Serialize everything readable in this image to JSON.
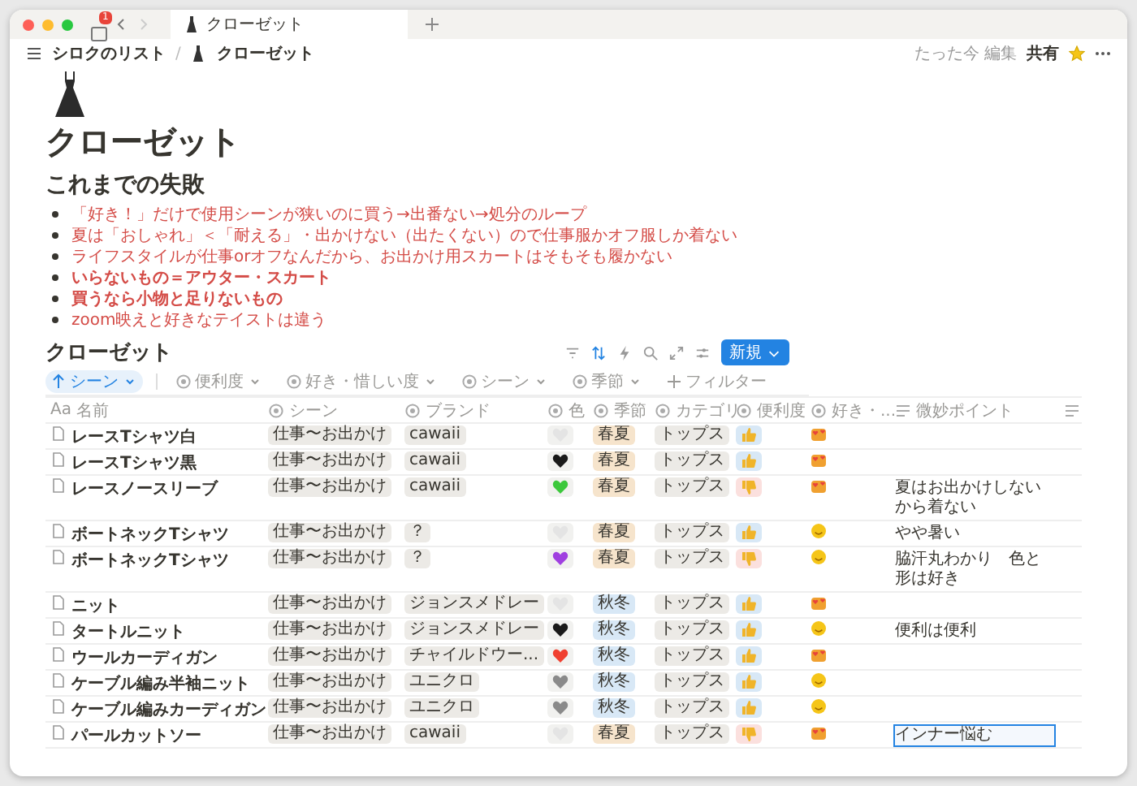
{
  "window": {
    "tab_title": "クローゼット",
    "sidebar_badge": "1"
  },
  "breadcrumb": {
    "items": [
      "シロクのリスト",
      "クローゼット"
    ],
    "separator": "/"
  },
  "topbar": {
    "edited": "たった今 編集",
    "share": "共有",
    "favorite": true
  },
  "page": {
    "title": "クローゼット",
    "heading": "これまでの失敗",
    "bullets": [
      {
        "text": "「好き！」だけで使用シーンが狭いのに買う→出番ない→処分のループ",
        "bold": false
      },
      {
        "text": "夏は「おしゃれ」＜「耐える」・出かけない（出たくない）ので仕事服かオフ服しか着ない",
        "bold": false
      },
      {
        "text": "ライフスタイルが仕事orオフなんだから、お出かけ用スカートはそもそも履かない",
        "bold": false
      },
      {
        "text": "いらないもの＝アウター・スカート",
        "bold": true
      },
      {
        "text": "買うなら小物と足りないもの",
        "bold": true
      },
      {
        "text": "zoom映えと好きなテイストは違う",
        "bold": false
      }
    ]
  },
  "database": {
    "title": "クローゼット",
    "new_button": "新規",
    "filters": [
      {
        "label": "シーン",
        "kind": "sort",
        "active": true
      },
      {
        "label": "便利度",
        "kind": "select",
        "active": false
      },
      {
        "label": "好き・惜しい度",
        "kind": "select",
        "active": false
      },
      {
        "label": "シーン",
        "kind": "select",
        "active": false
      },
      {
        "label": "季節",
        "kind": "select",
        "active": false
      },
      {
        "label": "フィルター",
        "kind": "add",
        "active": false
      }
    ],
    "columns": [
      {
        "label": "名前",
        "kind": "title",
        "prefix": "Aa"
      },
      {
        "label": "シーン",
        "kind": "select"
      },
      {
        "label": "ブランド",
        "kind": "select"
      },
      {
        "label": "色",
        "kind": "select"
      },
      {
        "label": "季節",
        "kind": "select"
      },
      {
        "label": "カテゴリ",
        "kind": "select"
      },
      {
        "label": "便利度",
        "kind": "select"
      },
      {
        "label": "好き・...",
        "kind": "select"
      },
      {
        "label": "微妙ポイント",
        "kind": "text"
      }
    ],
    "rows": [
      {
        "name": "レースTシャツ白",
        "scene": "仕事〜お出かけ",
        "brand": "cawaii",
        "color": "#e4e4e4",
        "season": {
          "label": "春夏",
          "color": "#f6e4cc"
        },
        "category": "トップス",
        "useful": {
          "kind": "up"
        },
        "liking": {
          "kind": "love"
        }
      },
      {
        "name": "レースTシャツ黒",
        "scene": "仕事〜お出かけ",
        "brand": "cawaii",
        "color": "#1a1a1a",
        "season": {
          "label": "春夏",
          "color": "#f6e4cc"
        },
        "category": "トップス",
        "useful": {
          "kind": "up"
        },
        "liking": {
          "kind": "love"
        }
      },
      {
        "name": "レースノースリーブ",
        "scene": "仕事〜お出かけ",
        "brand": "cawaii",
        "color": "#3cc83c",
        "season": {
          "label": "春夏",
          "color": "#f6e4cc"
        },
        "category": "トップス",
        "useful": {
          "kind": "down"
        },
        "liking": {
          "kind": "love"
        },
        "note": {
          "text": "夏はお出かけしないから着ない",
          "selected": false
        }
      },
      {
        "name": "ボートネックTシャツ",
        "scene": "仕事〜お出かけ",
        "brand": "？",
        "color": "#e4e4e4",
        "season": {
          "label": "春夏",
          "color": "#f6e4cc"
        },
        "category": "トップス",
        "useful": {
          "kind": "up"
        },
        "liking": {
          "kind": "ok"
        },
        "note": {
          "text": "やや暑い",
          "selected": false
        }
      },
      {
        "name": "ボートネックTシャツ",
        "scene": "仕事〜お出かけ",
        "brand": "？",
        "color": "#a040e0",
        "season": {
          "label": "春夏",
          "color": "#f6e4cc"
        },
        "category": "トップス",
        "useful": {
          "kind": "down"
        },
        "liking": {
          "kind": "ok"
        },
        "note": {
          "text": "脇汗丸わかり　色と形は好き",
          "selected": false
        }
      },
      {
        "name": "ニット",
        "scene": "仕事〜お出かけ",
        "brand": "ジョンスメドレー",
        "color": "#e4e4e4",
        "season": {
          "label": "秋冬",
          "color": "#d8e8f6"
        },
        "category": "トップス",
        "useful": {
          "kind": "up"
        },
        "liking": {
          "kind": "love"
        }
      },
      {
        "name": "タートルニット",
        "scene": "仕事〜お出かけ",
        "brand": "ジョンスメドレー",
        "color": "#1a1a1a",
        "season": {
          "label": "秋冬",
          "color": "#d8e8f6"
        },
        "category": "トップス",
        "useful": {
          "kind": "up"
        },
        "liking": {
          "kind": "ok"
        },
        "note": {
          "text": "便利は便利",
          "selected": false
        }
      },
      {
        "name": "ウールカーディガン",
        "scene": "仕事〜お出かけ",
        "brand": "チャイルドウー...",
        "color": "#f04030",
        "season": {
          "label": "秋冬",
          "color": "#d8e8f6"
        },
        "category": "トップス",
        "useful": {
          "kind": "up"
        },
        "liking": {
          "kind": "love"
        }
      },
      {
        "name": "ケーブル編み半袖ニット",
        "scene": "仕事〜お出かけ",
        "brand": "ユニクロ",
        "color": "#8a8a8a",
        "season": {
          "label": "秋冬",
          "color": "#d8e8f6"
        },
        "category": "トップス",
        "useful": {
          "kind": "up"
        },
        "liking": {
          "kind": "ok"
        }
      },
      {
        "name": "ケーブル編みカーディガン",
        "scene": "仕事〜お出かけ",
        "brand": "ユニクロ",
        "color": "#8a8a8a",
        "season": {
          "label": "秋冬",
          "color": "#d8e8f6"
        },
        "category": "トップス",
        "useful": {
          "kind": "up"
        },
        "liking": {
          "kind": "ok"
        }
      },
      {
        "name": "パールカットソー",
        "scene": "仕事〜お出かけ",
        "brand": "cawaii",
        "color": "#e4e4e4",
        "season": {
          "label": "春夏",
          "color": "#f6e4cc"
        },
        "category": "トップス",
        "useful": {
          "kind": "down"
        },
        "liking": {
          "kind": "love"
        },
        "note": {
          "text": "インナー悩む",
          "selected": true
        }
      }
    ]
  }
}
